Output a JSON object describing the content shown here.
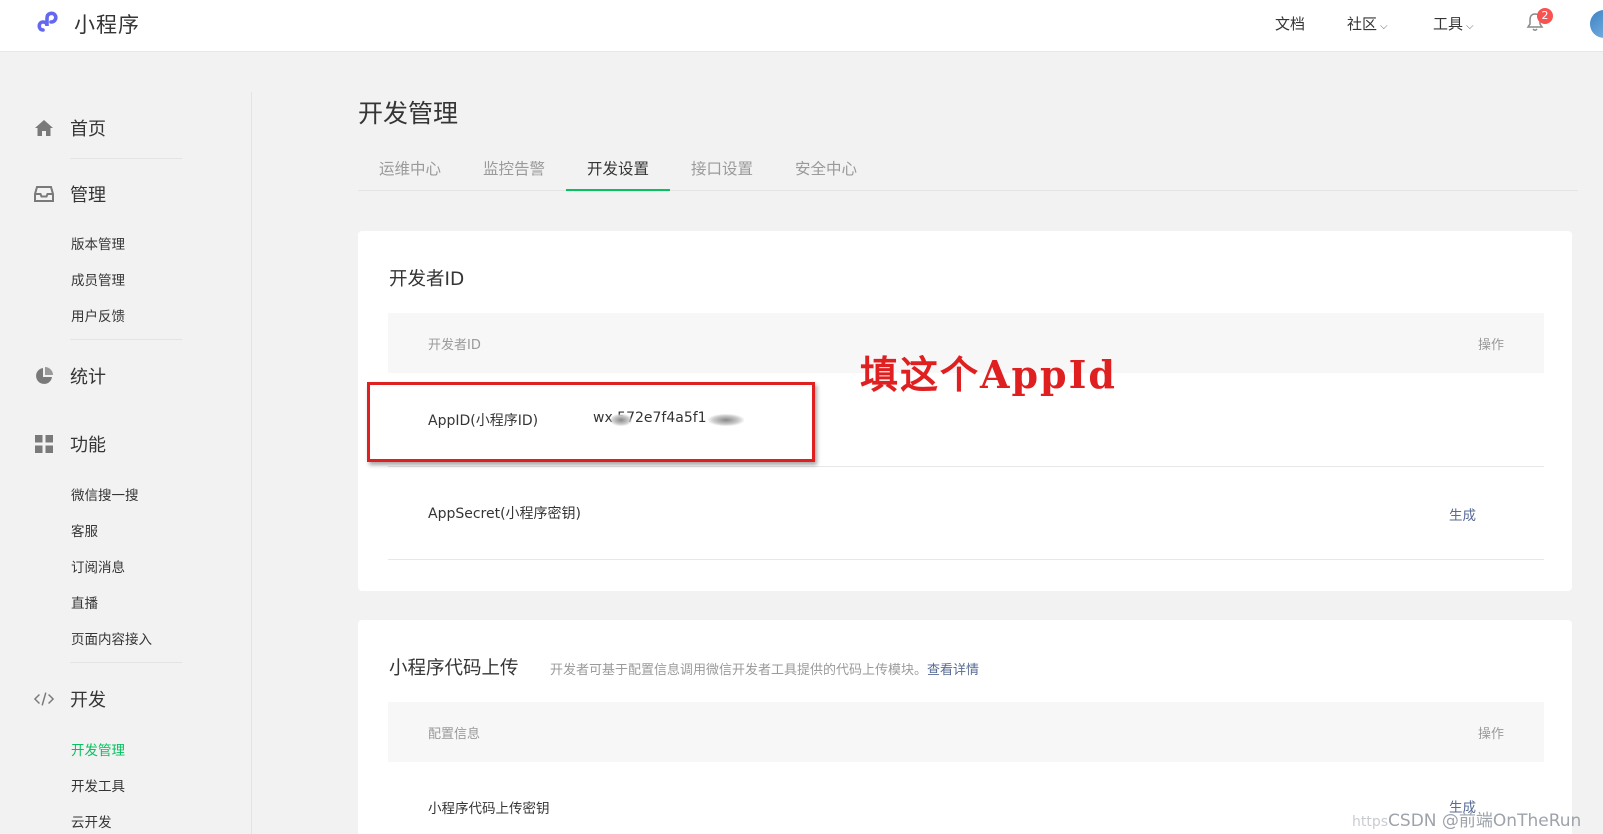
{
  "topbar": {
    "logo_text": "小程序",
    "nav": [
      {
        "label": "文档",
        "has_dropdown": false
      },
      {
        "label": "社区",
        "has_dropdown": true
      },
      {
        "label": "工具",
        "has_dropdown": true
      }
    ],
    "notification_count": "2"
  },
  "sidebar": {
    "sections": [
      {
        "key": "home",
        "label": "首页",
        "icon": "home-icon",
        "items": []
      },
      {
        "key": "manage",
        "label": "管理",
        "icon": "inbox-icon",
        "items": [
          "版本管理",
          "成员管理",
          "用户反馈"
        ]
      },
      {
        "key": "stats",
        "label": "统计",
        "icon": "pie-chart-icon",
        "items": []
      },
      {
        "key": "features",
        "label": "功能",
        "icon": "grid-icon",
        "items": [
          "微信搜一搜",
          "客服",
          "订阅消息",
          "直播",
          "页面内容接入"
        ]
      },
      {
        "key": "dev",
        "label": "开发",
        "icon": "code-icon",
        "items": [
          "开发管理",
          "开发工具",
          "云开发"
        ]
      }
    ],
    "active_item": "开发管理"
  },
  "main": {
    "title": "开发管理",
    "tabs": [
      "运维中心",
      "监控告警",
      "开发设置",
      "接口设置",
      "安全中心"
    ],
    "active_tab": "开发设置",
    "developer_id_card": {
      "title": "开发者ID",
      "header_col1": "开发者ID",
      "header_col2": "操作",
      "appid_label": "AppID(小程序ID)",
      "appid_value": "wx  572e7f4a5f1",
      "appsecret_label": "AppSecret(小程序密钥)",
      "appsecret_action": "生成"
    },
    "upload_card": {
      "title": "小程序代码上传",
      "description": "开发者可基于配置信息调用微信开发者工具提供的代码上传模块。",
      "details_link": "查看详情",
      "header_col1": "配置信息",
      "header_col2": "操作",
      "row_label": "小程序代码上传密钥",
      "row_action": "生成"
    }
  },
  "annotation": {
    "text": "填这个AppId",
    "color": "#e02020"
  },
  "watermark": {
    "prefix": "https",
    "text": "CSDN @前端OnTheRun"
  },
  "colors": {
    "accent_green": "#07c160",
    "link_blue": "#576b95",
    "badge_red": "#fa5151"
  }
}
